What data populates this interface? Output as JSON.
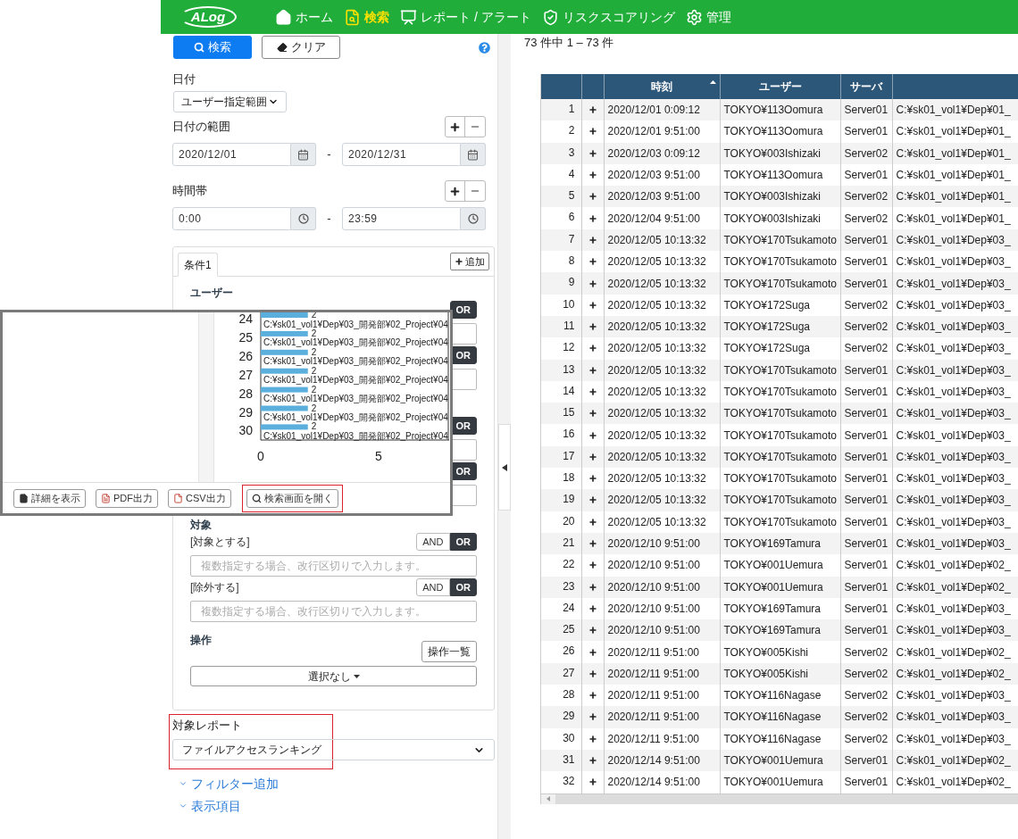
{
  "nav": {
    "logo": "ALog",
    "items": [
      {
        "kind": "home",
        "label": "ホーム",
        "selected": false
      },
      {
        "kind": "search",
        "label": "検索",
        "selected": true
      },
      {
        "kind": "report",
        "label": "レポート / アラート",
        "selected": false
      },
      {
        "kind": "risk",
        "label": "リスクスコアリング",
        "selected": false
      },
      {
        "kind": "admin",
        "label": "管理",
        "selected": false
      }
    ]
  },
  "search_panel": {
    "search_button": "検索",
    "clear_button": "クリア",
    "date_label": "日付",
    "date_mode": "ユーザー指定範囲",
    "date_range_label": "日付の範囲",
    "date_from": "2020/12/01",
    "date_to": "2020/12/31",
    "range_separator": "-",
    "time_label": "時間帯",
    "time_from": "0:00",
    "time_to": "23:59",
    "time_separator": "-",
    "conditions": {
      "tabs": [
        {
          "label": "条件1",
          "selected": true
        }
      ],
      "add_button": "追加",
      "sections": [
        {
          "title": "ユーザー",
          "filters": [
            {
              "toggle": [
                {
                  "label": "OR",
                  "selected": true
                }
              ]
            },
            {
              "toggle": [
                {
                  "label": "OR",
                  "selected": true
                }
              ]
            }
          ]
        },
        {
          "filters": [
            {
              "toggle": [
                {
                  "label": "OR",
                  "selected": true
                }
              ]
            },
            {
              "toggle": [
                {
                  "label": "OR",
                  "selected": true
                }
              ]
            }
          ]
        },
        {
          "title": "対象",
          "filters": [
            {
              "label": "[対象とする]",
              "toggle": [
                {
                  "label": "AND",
                  "selected": false
                },
                {
                  "label": "OR",
                  "selected": true
                }
              ],
              "placeholder": "複数指定する場合、改行区切りで入力します。"
            },
            {
              "label": "[除外する]",
              "toggle": [
                {
                  "label": "AND",
                  "selected": false
                },
                {
                  "label": "OR",
                  "selected": true
                }
              ],
              "placeholder": "複数指定する場合、改行区切りで入力します。"
            }
          ]
        }
      ],
      "operation_title": "操作",
      "operation_list_button": "操作一覧",
      "operation_select": "選択なし"
    },
    "report": {
      "label": "対象レポート",
      "value": "ファイルアクセスランキング",
      "highlighted": true
    },
    "links": [
      "フィルター追加",
      "表示項目"
    ]
  },
  "report_popup": {
    "chart_data": {
      "type": "bar",
      "orientation": "horizontal",
      "categories": [
        "24",
        "25",
        "26",
        "27",
        "28",
        "29",
        "30"
      ],
      "values": [
        2,
        2,
        2,
        2,
        2,
        2,
        2
      ],
      "xlim": [
        0,
        8
      ],
      "xticks": [
        0,
        5
      ],
      "data_labels": true
    },
    "bar_captions": [
      "C:¥sk01_vol1¥Dep¥03_開発部¥02_Project¥04",
      "C:¥sk01_vol1¥Dep¥03_開発部¥02_Project¥04",
      "C:¥sk01_vol1¥Dep¥03_開発部¥02_Project¥04",
      "C:¥sk01_vol1¥Dep¥03_開発部¥02_Project¥04",
      "C:¥sk01_vol1¥Dep¥03_開発部¥02_Project¥04",
      "C:¥sk01_vol1¥Dep¥03_開発部¥02_Project¥04",
      "C:¥sk01_vol1¥Dep¥03_開発部¥02_Project¥04"
    ],
    "buttons": [
      {
        "kind": "details",
        "label": "詳細を表示",
        "highlighted": false
      },
      {
        "kind": "pdf",
        "label": "PDF出力",
        "highlighted": false
      },
      {
        "kind": "csv",
        "label": "CSV出力",
        "highlighted": false
      },
      {
        "kind": "search",
        "label": "検索画面を開く",
        "highlighted": true
      }
    ]
  },
  "results": {
    "summary": "73 件中 1 – 73 件",
    "columns": [
      {
        "label": "時刻",
        "sorted": true
      },
      {
        "label": "ユーザー",
        "sorted": false
      },
      {
        "label": "サーバ",
        "sorted": false
      }
    ],
    "rows": [
      {
        "no": "1",
        "time": "2020/12/01 0:09:12",
        "user": "TOKYO¥113Oomura",
        "server": "Server01",
        "path": "C:¥sk01_vol1¥Dep¥01_"
      },
      {
        "no": "2",
        "time": "2020/12/01 9:51:00",
        "user": "TOKYO¥113Oomura",
        "server": "Server01",
        "path": "C:¥sk01_vol1¥Dep¥01_"
      },
      {
        "no": "3",
        "time": "2020/12/03 0:09:12",
        "user": "TOKYO¥003Ishizaki",
        "server": "Server02",
        "path": "C:¥sk01_vol1¥Dep¥01_"
      },
      {
        "no": "4",
        "time": "2020/12/03 9:51:00",
        "user": "TOKYO¥113Oomura",
        "server": "Server01",
        "path": "C:¥sk01_vol1¥Dep¥01_"
      },
      {
        "no": "5",
        "time": "2020/12/03 9:51:00",
        "user": "TOKYO¥003Ishizaki",
        "server": "Server02",
        "path": "C:¥sk01_vol1¥Dep¥01_"
      },
      {
        "no": "6",
        "time": "2020/12/04 9:51:00",
        "user": "TOKYO¥003Ishizaki",
        "server": "Server02",
        "path": "C:¥sk01_vol1¥Dep¥01_"
      },
      {
        "no": "7",
        "time": "2020/12/05 10:13:32",
        "user": "TOKYO¥170Tsukamoto",
        "server": "Server01",
        "path": "C:¥sk01_vol1¥Dep¥03_"
      },
      {
        "no": "8",
        "time": "2020/12/05 10:13:32",
        "user": "TOKYO¥170Tsukamoto",
        "server": "Server01",
        "path": "C:¥sk01_vol1¥Dep¥03_"
      },
      {
        "no": "9",
        "time": "2020/12/05 10:13:32",
        "user": "TOKYO¥170Tsukamoto",
        "server": "Server01",
        "path": "C:¥sk01_vol1¥Dep¥03_"
      },
      {
        "no": "10",
        "time": "2020/12/05 10:13:32",
        "user": "TOKYO¥172Suga",
        "server": "Server02",
        "path": "C:¥sk01_vol1¥Dep¥03_"
      },
      {
        "no": "11",
        "time": "2020/12/05 10:13:32",
        "user": "TOKYO¥172Suga",
        "server": "Server02",
        "path": "C:¥sk01_vol1¥Dep¥03_"
      },
      {
        "no": "12",
        "time": "2020/12/05 10:13:32",
        "user": "TOKYO¥172Suga",
        "server": "Server02",
        "path": "C:¥sk01_vol1¥Dep¥03_"
      },
      {
        "no": "13",
        "time": "2020/12/05 10:13:32",
        "user": "TOKYO¥170Tsukamoto",
        "server": "Server01",
        "path": "C:¥sk01_vol1¥Dep¥03_"
      },
      {
        "no": "14",
        "time": "2020/12/05 10:13:32",
        "user": "TOKYO¥170Tsukamoto",
        "server": "Server01",
        "path": "C:¥sk01_vol1¥Dep¥03_"
      },
      {
        "no": "15",
        "time": "2020/12/05 10:13:32",
        "user": "TOKYO¥170Tsukamoto",
        "server": "Server01",
        "path": "C:¥sk01_vol1¥Dep¥03_"
      },
      {
        "no": "16",
        "time": "2020/12/05 10:13:32",
        "user": "TOKYO¥170Tsukamoto",
        "server": "Server01",
        "path": "C:¥sk01_vol1¥Dep¥03_"
      },
      {
        "no": "17",
        "time": "2020/12/05 10:13:32",
        "user": "TOKYO¥170Tsukamoto",
        "server": "Server01",
        "path": "C:¥sk01_vol1¥Dep¥03_"
      },
      {
        "no": "18",
        "time": "2020/12/05 10:13:32",
        "user": "TOKYO¥170Tsukamoto",
        "server": "Server01",
        "path": "C:¥sk01_vol1¥Dep¥03_"
      },
      {
        "no": "19",
        "time": "2020/12/05 10:13:32",
        "user": "TOKYO¥170Tsukamoto",
        "server": "Server01",
        "path": "C:¥sk01_vol1¥Dep¥03_"
      },
      {
        "no": "20",
        "time": "2020/12/05 10:13:32",
        "user": "TOKYO¥170Tsukamoto",
        "server": "Server01",
        "path": "C:¥sk01_vol1¥Dep¥03_"
      },
      {
        "no": "21",
        "time": "2020/12/10 9:51:00",
        "user": "TOKYO¥169Tamura",
        "server": "Server01",
        "path": "C:¥sk01_vol1¥Dep¥03_"
      },
      {
        "no": "22",
        "time": "2020/12/10 9:51:00",
        "user": "TOKYO¥001Uemura",
        "server": "Server01",
        "path": "C:¥sk01_vol1¥Dep¥02_"
      },
      {
        "no": "23",
        "time": "2020/12/10 9:51:00",
        "user": "TOKYO¥001Uemura",
        "server": "Server01",
        "path": "C:¥sk01_vol1¥Dep¥02_"
      },
      {
        "no": "24",
        "time": "2020/12/10 9:51:00",
        "user": "TOKYO¥169Tamura",
        "server": "Server01",
        "path": "C:¥sk01_vol1¥Dep¥03_"
      },
      {
        "no": "25",
        "time": "2020/12/10 9:51:00",
        "user": "TOKYO¥169Tamura",
        "server": "Server01",
        "path": "C:¥sk01_vol1¥Dep¥03_"
      },
      {
        "no": "26",
        "time": "2020/12/11 9:51:00",
        "user": "TOKYO¥005Kishi",
        "server": "Server02",
        "path": "C:¥sk01_vol1¥Dep¥02_"
      },
      {
        "no": "27",
        "time": "2020/12/11 9:51:00",
        "user": "TOKYO¥005Kishi",
        "server": "Server02",
        "path": "C:¥sk01_vol1¥Dep¥02_"
      },
      {
        "no": "28",
        "time": "2020/12/11 9:51:00",
        "user": "TOKYO¥116Nagase",
        "server": "Server02",
        "path": "C:¥sk01_vol1¥Dep¥03_"
      },
      {
        "no": "29",
        "time": "2020/12/11 9:51:00",
        "user": "TOKYO¥116Nagase",
        "server": "Server02",
        "path": "C:¥sk01_vol1¥Dep¥03_"
      },
      {
        "no": "30",
        "time": "2020/12/11 9:51:00",
        "user": "TOKYO¥116Nagase",
        "server": "Server02",
        "path": "C:¥sk01_vol1¥Dep¥03_"
      },
      {
        "no": "31",
        "time": "2020/12/14 9:51:00",
        "user": "TOKYO¥001Uemura",
        "server": "Server01",
        "path": "C:¥sk01_vol1¥Dep¥02_"
      },
      {
        "no": "32",
        "time": "2020/12/14 9:51:00",
        "user": "TOKYO¥001Uemura",
        "server": "Server01",
        "path": "C:¥sk01_vol1¥Dep¥02_"
      }
    ]
  }
}
